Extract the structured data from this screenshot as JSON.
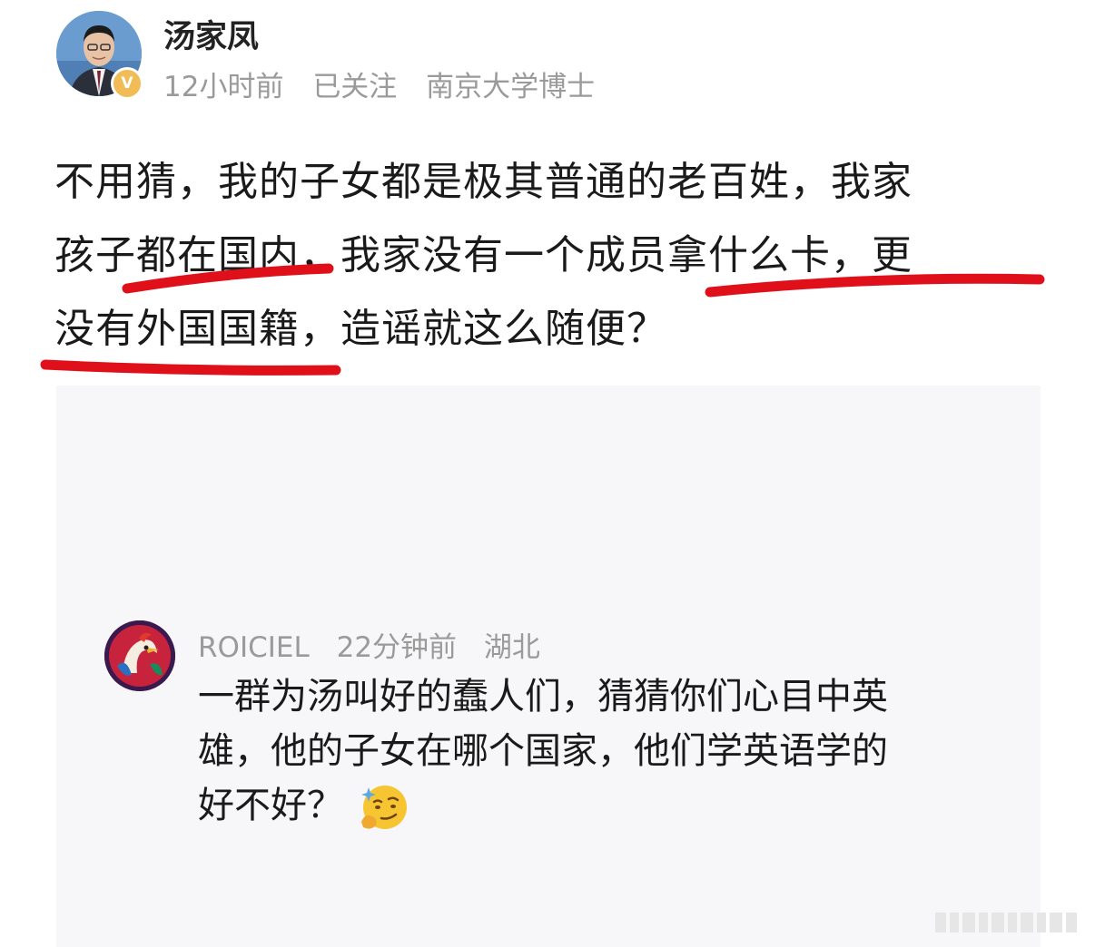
{
  "post": {
    "author_name": "汤家凤",
    "verified_badge": "V",
    "meta": [
      "12小时前",
      "已关注",
      "南京大学博士"
    ],
    "content_lines": [
      "不用猜，我的子女都是极其普通的老百姓，我家",
      "孩子都在国内，我家没有一个成员拿什么卡，更",
      "没有外国国籍，造谣就这么随便？"
    ],
    "annotation_color": "#e0101a"
  },
  "comment": {
    "username": "ROICIEL",
    "time": "22分钟前",
    "location": "湖北",
    "content_lines": [
      "一群为汤叫好的蠢人们，猜猜你们心目中英",
      "雄，他的子女在哪个国家，他们学英语学的",
      "好不好？"
    ],
    "emoji": "thinking-smirk-emoji"
  },
  "colors": {
    "meta_gray": "#9a9a9a",
    "panel_bg": "#f7f7f9",
    "badge_gold": "#f1bb55"
  }
}
